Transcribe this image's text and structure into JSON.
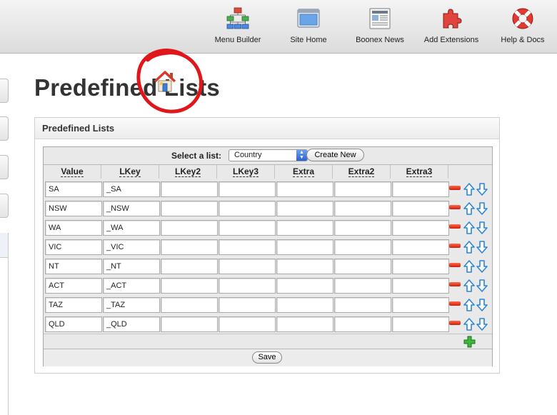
{
  "toolbar": {
    "items": [
      {
        "label": "Menu Builder",
        "icon": "menu-builder-icon"
      },
      {
        "label": "Site Home",
        "icon": "site-home-icon"
      },
      {
        "label": "Boonex News",
        "icon": "news-icon"
      },
      {
        "label": "Add Extensions",
        "icon": "puzzle-icon"
      },
      {
        "label": "Help & Docs",
        "icon": "lifebuoy-icon"
      }
    ]
  },
  "page": {
    "title": "Predefined Lists"
  },
  "panel": {
    "title": "Predefined Lists",
    "select_label": "Select a list:",
    "selected_list": "Country",
    "create_button": "Create New",
    "columns": [
      "Value",
      "LKey",
      "LKey2",
      "LKey3",
      "Extra",
      "Extra2",
      "Extra3"
    ],
    "rows": [
      {
        "value": "SA",
        "lkey": "_SA"
      },
      {
        "value": "NSW",
        "lkey": "_NSW"
      },
      {
        "value": "WA",
        "lkey": "_WA"
      },
      {
        "value": "VIC",
        "lkey": "_VIC"
      },
      {
        "value": "NT",
        "lkey": "_NT"
      },
      {
        "value": "ACT",
        "lkey": "_ACT"
      },
      {
        "value": "TAZ",
        "lkey": "_TAZ"
      },
      {
        "value": "QLD",
        "lkey": "_QLD"
      }
    ],
    "save_button": "Save"
  },
  "colors": {
    "annotation_red": "#e0161a",
    "remove_red": "#d9261a",
    "arrow_blue": "#2a86d6",
    "add_green": "#2ea82e"
  }
}
